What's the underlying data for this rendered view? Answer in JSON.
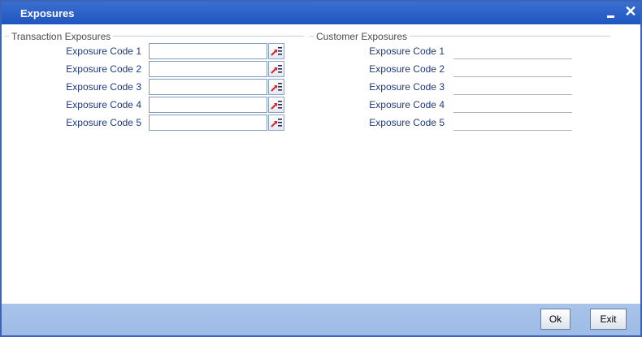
{
  "window": {
    "title": "Exposures",
    "close_glyph": "✕"
  },
  "transaction_exposures": {
    "legend": "Transaction Exposures",
    "fields": [
      {
        "label": "Exposure Code 1",
        "value": ""
      },
      {
        "label": "Exposure Code 2",
        "value": ""
      },
      {
        "label": "Exposure Code 3",
        "value": ""
      },
      {
        "label": "Exposure Code 4",
        "value": ""
      },
      {
        "label": "Exposure Code 5",
        "value": ""
      }
    ],
    "lov_icon": "list-of-values-icon"
  },
  "customer_exposures": {
    "legend": "Customer Exposures",
    "fields": [
      {
        "label": "Exposure Code 1",
        "value": ""
      },
      {
        "label": "Exposure Code 2",
        "value": ""
      },
      {
        "label": "Exposure Code 3",
        "value": ""
      },
      {
        "label": "Exposure Code 4",
        "value": ""
      },
      {
        "label": "Exposure Code 5",
        "value": ""
      }
    ]
  },
  "footer": {
    "ok_label": "Ok",
    "exit_label": "Exit"
  },
  "colors": {
    "titlebar": "#1f55bf",
    "footer": "#a9c4ea",
    "label_text": "#1f3a78"
  }
}
